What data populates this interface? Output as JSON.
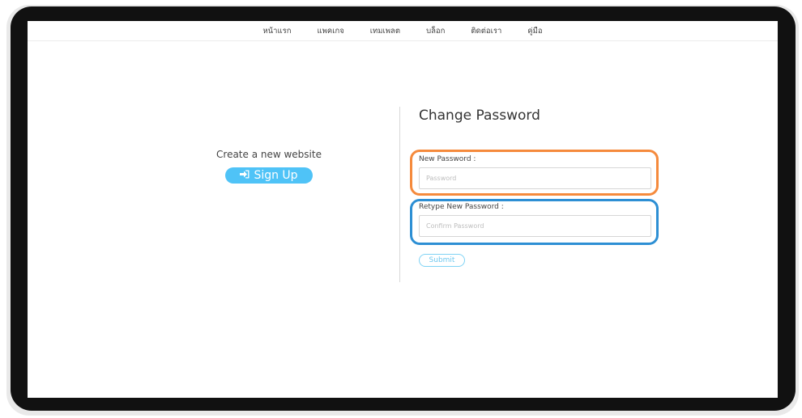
{
  "nav": {
    "items": [
      "หน้าแรก",
      "แพคเกจ",
      "เทมเพลต",
      "บล็อก",
      "ติดต่อเรา",
      "คู่มือ"
    ]
  },
  "left": {
    "create_text": "Create a new website",
    "signup_label": "Sign Up",
    "signup_icon": "sign-in-icon"
  },
  "form": {
    "title": "Change Password",
    "new_password_label": "New Password :",
    "new_password_placeholder": "Password",
    "retype_label": "Retype New Password :",
    "retype_placeholder": "Confirm Password",
    "submit_label": "Submit"
  },
  "annotations": {
    "new_password_highlight_color": "#f58a3c",
    "retype_highlight_color": "#2d8fd4"
  },
  "colors": {
    "accent": "#4fc3f7",
    "frame": "#111111"
  }
}
